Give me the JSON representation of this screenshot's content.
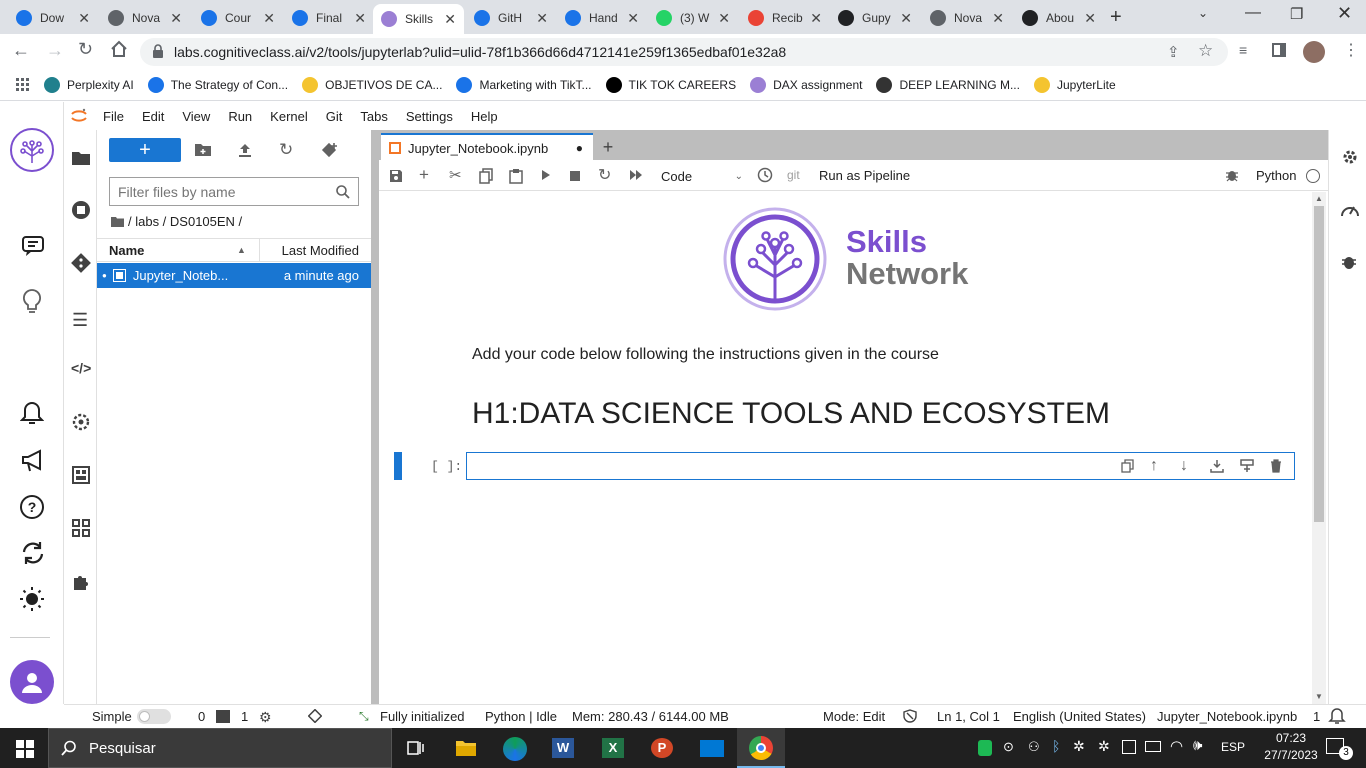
{
  "browser": {
    "tabs": [
      {
        "label": "Dow",
        "fav": "#1a73e8",
        "icon": "download-icon"
      },
      {
        "label": "Nova",
        "fav": "#5f6368",
        "icon": "chrome-icon"
      },
      {
        "label": "Cour",
        "fav": "#1a73e8",
        "icon": "coursera-icon"
      },
      {
        "label": "Final",
        "fav": "#1a73e8",
        "icon": "coursera-icon"
      },
      {
        "label": "Skills",
        "fav": "#9b7fd4",
        "icon": "skills-icon",
        "active": true
      },
      {
        "label": "GitH",
        "fav": "#1a73e8",
        "icon": "coursera-icon"
      },
      {
        "label": "Hand",
        "fav": "#1a73e8",
        "icon": "coursera-icon"
      },
      {
        "label": "(3) W",
        "fav": "#25d366",
        "icon": "whatsapp-icon"
      },
      {
        "label": "Recib",
        "fav": "#ea4335",
        "icon": "gmail-icon"
      },
      {
        "label": "Gupy",
        "fav": "#202124",
        "icon": "gupy-icon"
      },
      {
        "label": "Nova",
        "fav": "#5f6368",
        "icon": "chrome-icon"
      },
      {
        "label": "Abou",
        "fav": "#202124",
        "icon": "github-icon"
      }
    ],
    "url": "labs.cognitiveclass.ai/v2/tools/jupyterlab?ulid=ulid-78f1b366d66d4712141e259f1365edbaf01e32a8",
    "bookmarks": [
      {
        "label": "Perplexity AI",
        "color": "#20808d"
      },
      {
        "label": "The Strategy of Con...",
        "color": "#1a73e8"
      },
      {
        "label": "OBJETIVOS DE CA...",
        "color": "#f4c430"
      },
      {
        "label": "Marketing with TikT...",
        "color": "#1a73e8"
      },
      {
        "label": "TIK TOK CAREERS",
        "color": "#000000"
      },
      {
        "label": "DAX assignment",
        "color": "#9b7fd4"
      },
      {
        "label": "DEEP LEARNING M...",
        "color": "#333333"
      },
      {
        "label": "JupyterLite",
        "color": "#f4c430"
      }
    ]
  },
  "menu": [
    "File",
    "Edit",
    "View",
    "Run",
    "Kernel",
    "Git",
    "Tabs",
    "Settings",
    "Help"
  ],
  "filebrowser": {
    "filter_placeholder": "Filter files by name",
    "breadcrumb": "/ labs / DS0105EN /",
    "col_name": "Name",
    "col_modified": "Last Modified",
    "files": [
      {
        "name": "Jupyter_Noteb...",
        "modified": "a minute ago"
      }
    ]
  },
  "notebook": {
    "tab_label": "Jupyter_Notebook.ipynb",
    "cell_type": "Code",
    "git_label": "git",
    "pipeline_label": "Run as Pipeline",
    "kernel": "Python",
    "logo_line1": "Skills",
    "logo_line2": "Network",
    "instructions": "Add your code below following the instructions given in the course",
    "heading": "H1:DATA SCIENCE TOOLS AND ECOSYSTEM",
    "prompt": "[ ]:"
  },
  "status": {
    "mode_label": "Simple",
    "terminals": "0",
    "kernels": "1",
    "init": "Fully initialized",
    "kernel_state": "Python | Idle",
    "mem": "Mem: 280.43 / 6144.00 MB",
    "mode": "Mode: Edit",
    "cursor": "Ln 1, Col 1",
    "lang": "English (United States)",
    "file": "Jupyter_Notebook.ipynb",
    "count": "1"
  },
  "taskbar": {
    "search": "Pesquisar",
    "lang": "ESP",
    "time": "07:23",
    "date": "27/7/2023",
    "notif": "3"
  },
  "colors": {
    "accent": "#1976d2",
    "brand_purple": "#7b4fcf",
    "jupyter_orange": "#f37626"
  }
}
